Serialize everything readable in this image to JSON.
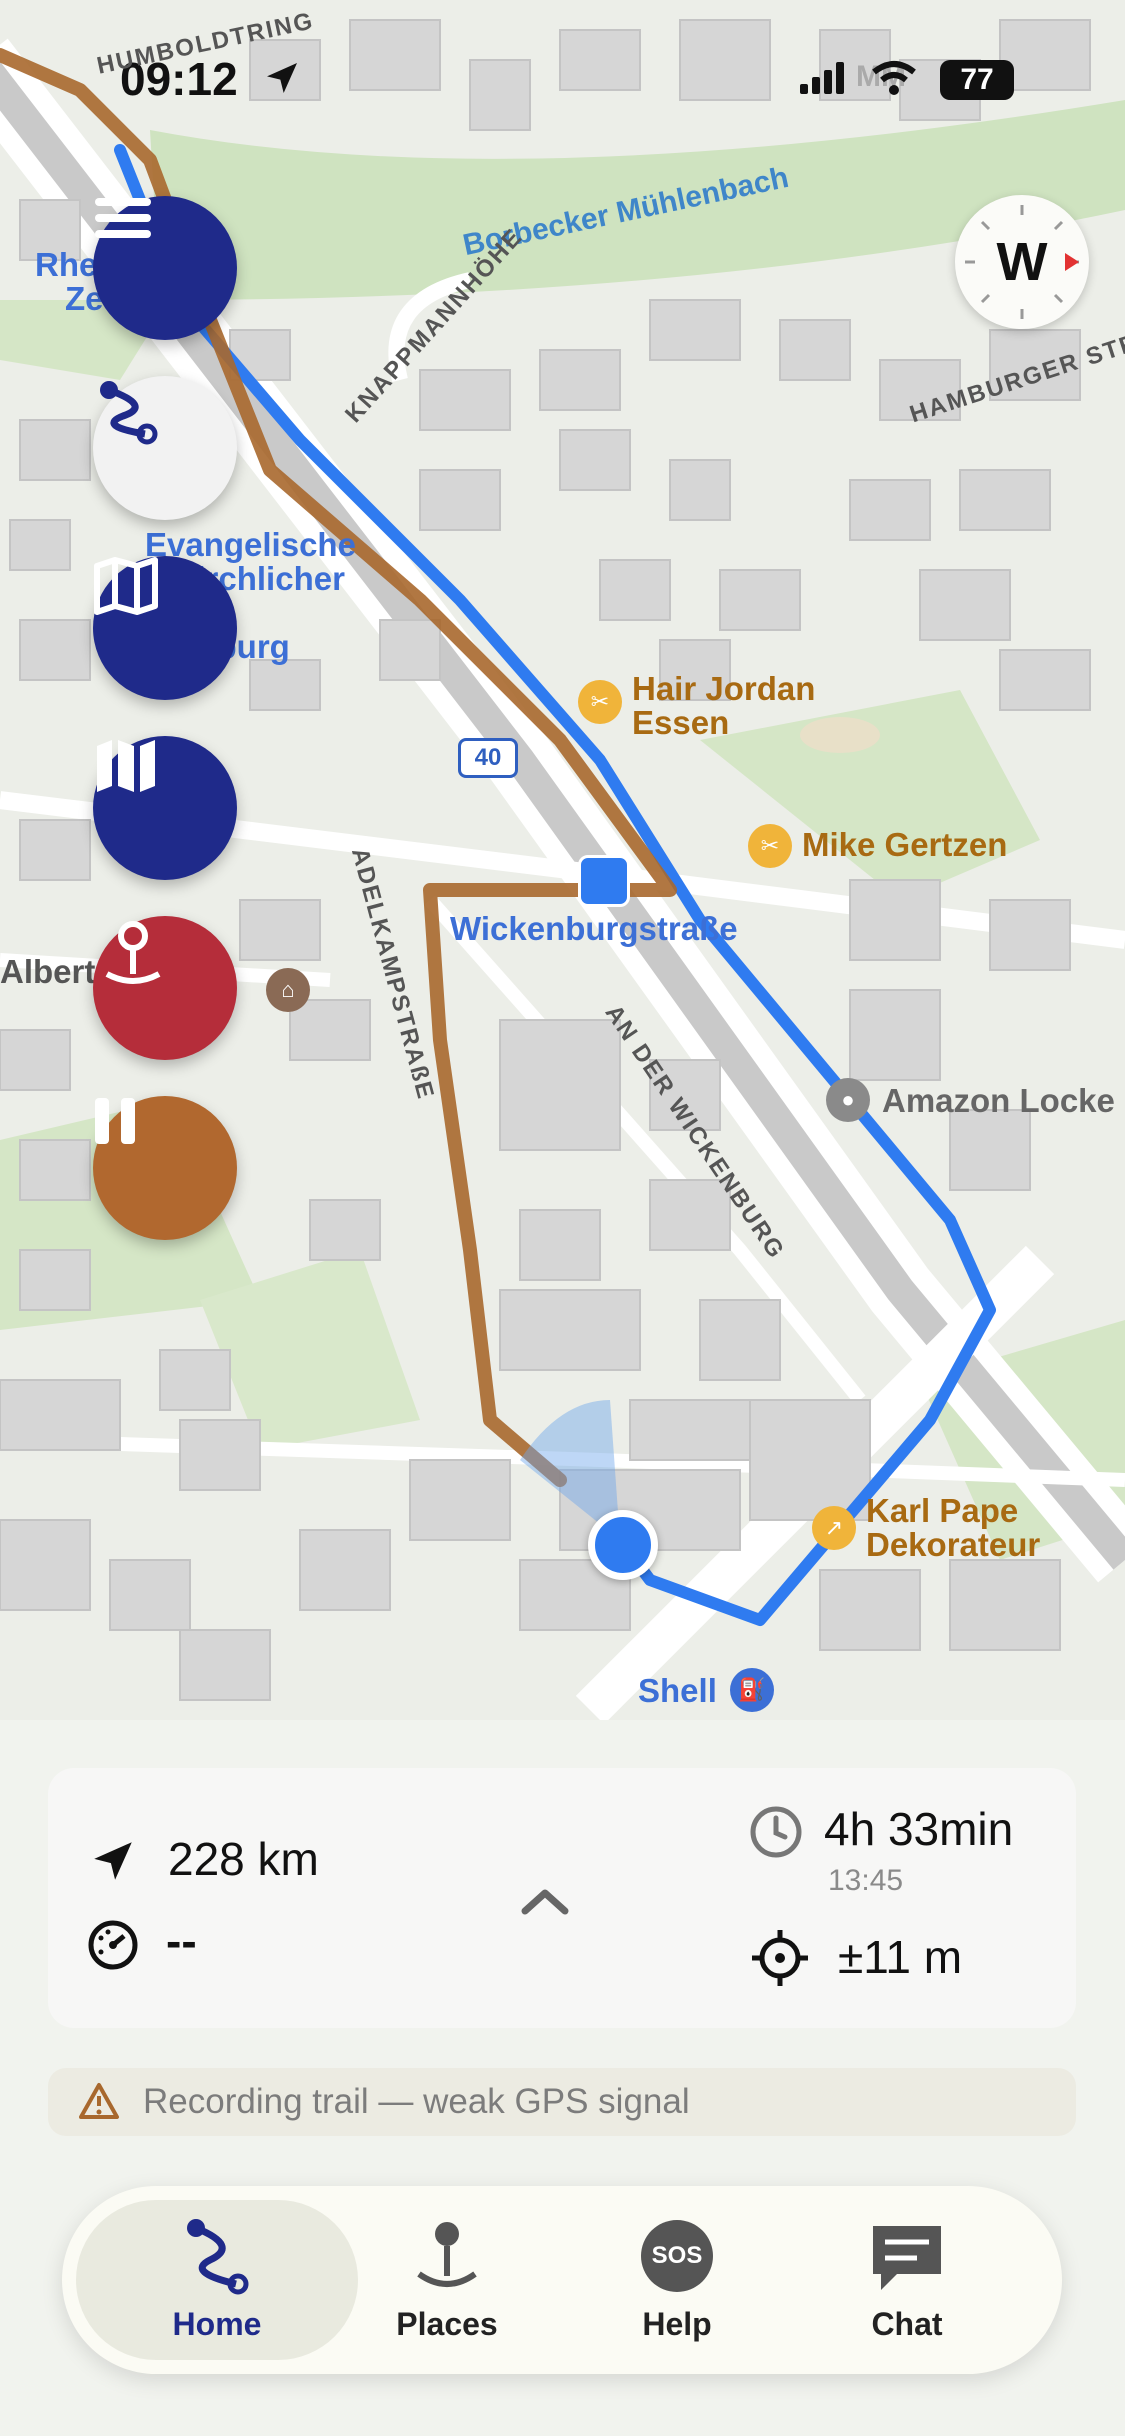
{
  "status_bar": {
    "time": "09:12",
    "carrier": "MM",
    "battery": "77"
  },
  "map": {
    "street_labels": [
      "HUMBOLDTRING",
      "KNAPPMANNHÖHE",
      "HAMBURGER STR",
      "ADELKAMPSTRAßE",
      "AN DER WICKENBURG"
    ],
    "water_label": "Borbecker Mühlenbach",
    "road_shield": "40",
    "station": "Wickenburgstraße",
    "pois": {
      "hair": [
        "Hair Jordan",
        "Essen"
      ],
      "mike": "Mike Gertzen",
      "amazon": "Amazon Locke",
      "karl": [
        "Karl Pape",
        "Dekorateur"
      ],
      "shell": "Shell",
      "evangelische": [
        "Evangelische",
        "…kirchlicher",
        "…r",
        "…enburg"
      ],
      "rhe": [
        "Rhe",
        "Ze"
      ],
      "albert": [
        "Albert",
        "…n",
        "…e"
      ]
    },
    "compass_letter": "W",
    "accent_route": "#2f7bf0",
    "accent_trail": "#a8682e"
  },
  "fabs": [
    {
      "name": "menu-button",
      "icon": "hamburger-icon"
    },
    {
      "name": "route-button",
      "icon": "route-icon"
    },
    {
      "name": "map-outline-button",
      "icon": "map-outline-icon"
    },
    {
      "name": "map-filled-button",
      "icon": "map-filled-icon"
    },
    {
      "name": "add-place-button",
      "icon": "pin-icon"
    },
    {
      "name": "pause-button",
      "icon": "pause-icon"
    }
  ],
  "stats": {
    "distance": "228 km",
    "speed": "--",
    "duration": "4h 33min",
    "time": "13:45",
    "accuracy": "±11 m"
  },
  "warning": "Recording trail — weak GPS signal",
  "tabs": [
    {
      "label": "Home",
      "icon": "route-icon"
    },
    {
      "label": "Places",
      "icon": "pin-icon"
    },
    {
      "label": "Help",
      "icon": "sos-icon"
    },
    {
      "label": "Chat",
      "icon": "chat-icon"
    }
  ],
  "help_badge": "SOS"
}
